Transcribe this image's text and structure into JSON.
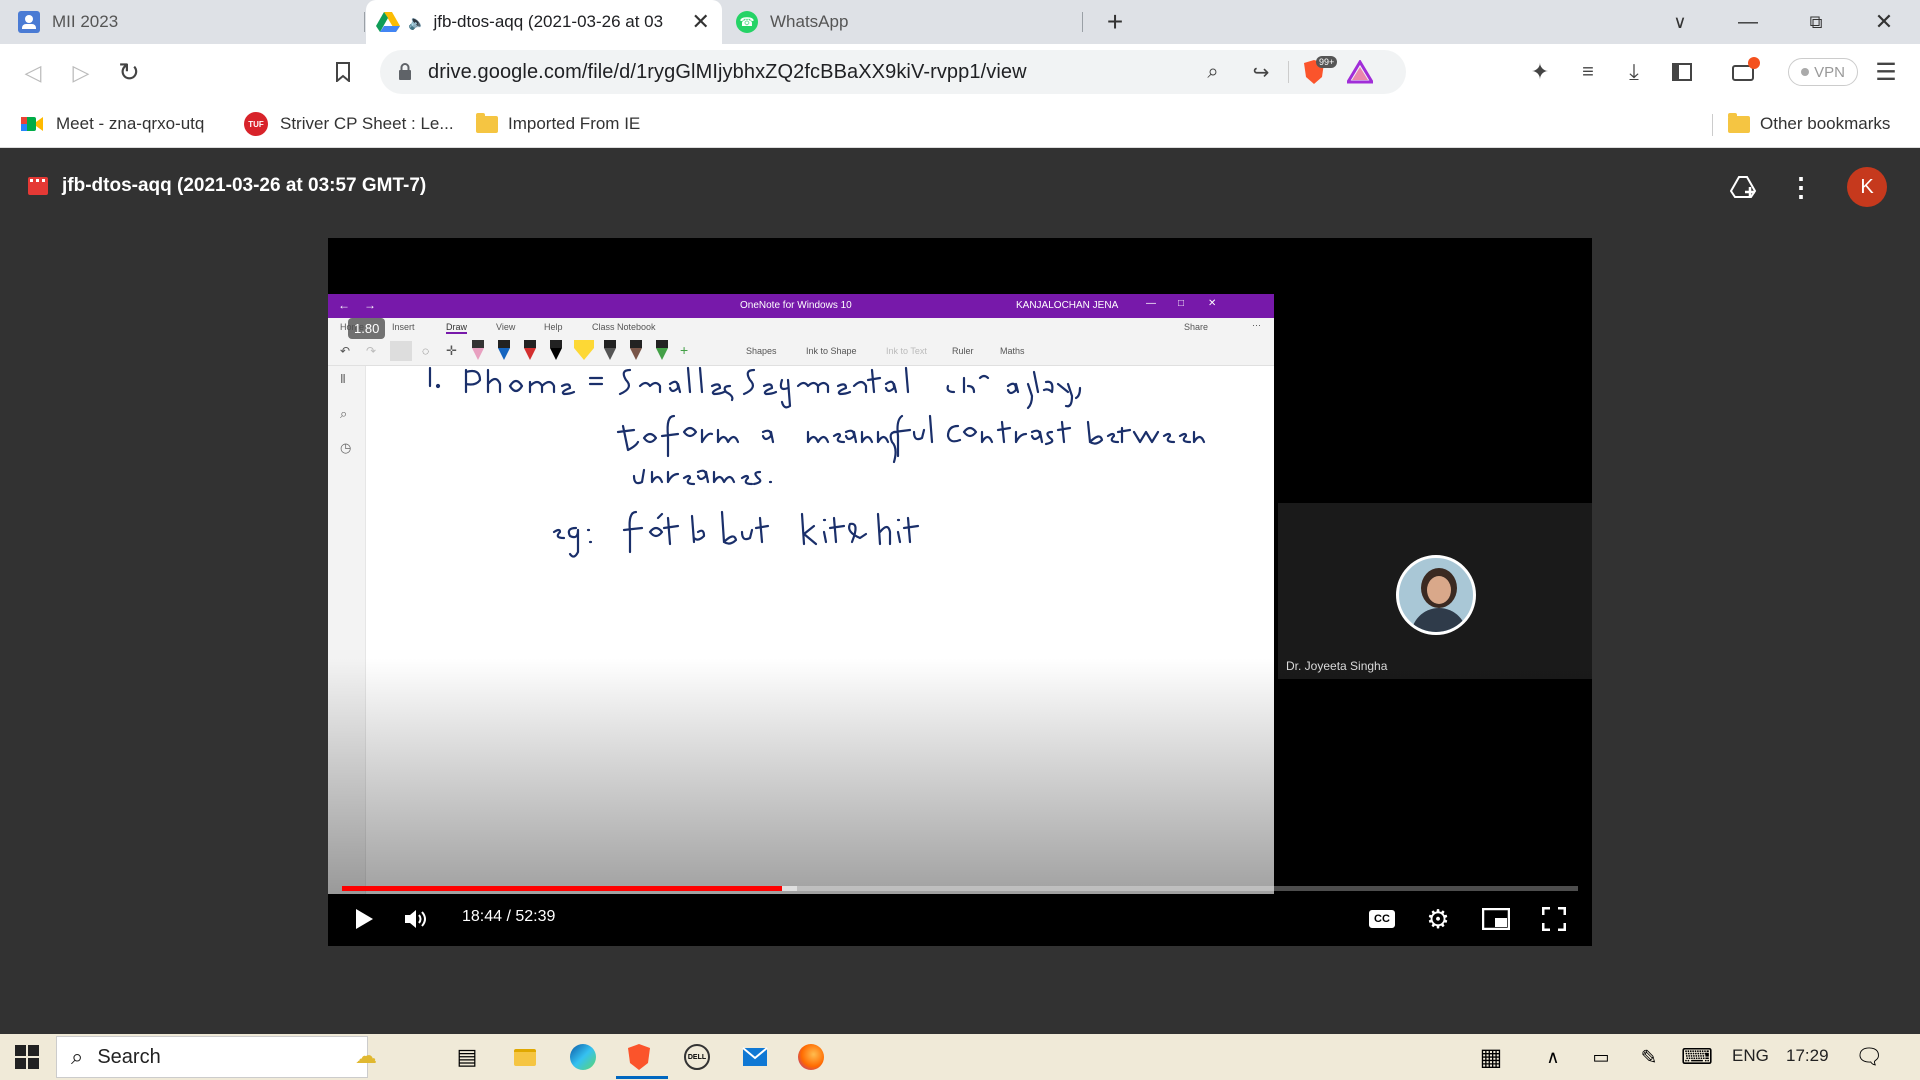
{
  "browser": {
    "tabs": [
      {
        "label": "MII 2023",
        "active": false
      },
      {
        "label": "jfb-dtos-aqq (2021-03-26 at 03",
        "active": true
      },
      {
        "label": "WhatsApp",
        "active": false
      }
    ],
    "url": "drive.google.com/file/d/1rygGlMIjybhxZQ2fcBBaXX9kiV-rvpp1/view",
    "brave_badge": "99+",
    "vpn_label": "VPN",
    "bookmarks": [
      {
        "label": "Meet - zna-qrxo-utq",
        "icon": "google-meet-icon"
      },
      {
        "label": "Striver CP Sheet : Le...",
        "icon": "tuf-icon"
      },
      {
        "label": "Imported From IE",
        "icon": "folder-icon"
      }
    ],
    "other_bookmarks": "Other bookmarks"
  },
  "drive": {
    "file_title": "jfb-dtos-aqq (2021-03-26 at 03:57 GMT-7)",
    "avatar_letter": "K"
  },
  "video": {
    "onenote": {
      "window_title": "OneNote for Windows 10",
      "user": "KANJALOCHAN JENA",
      "menu": [
        "Home",
        "Insert",
        "Draw",
        "View",
        "Help",
        "Class Notebook"
      ],
      "tools": [
        "Shapes",
        "Ink to Shape",
        "Ink to Text",
        "Ruler",
        "Maths"
      ],
      "share_label": "Share"
    },
    "speed": "1.80",
    "participant_name": "Dr. Joyeeta Singha",
    "current_time": "18:44",
    "duration": "52:39",
    "time_display": "18:44 / 52:39",
    "progress_fraction": 0.356
  },
  "taskbar": {
    "search_placeholder": "Search",
    "lang": "ENG",
    "clock": "17:29"
  },
  "colors": {
    "accent_red": "#ff0000",
    "onenote_purple": "#7719aa",
    "drive_bg": "#323232",
    "avatar": "#c6391d"
  }
}
